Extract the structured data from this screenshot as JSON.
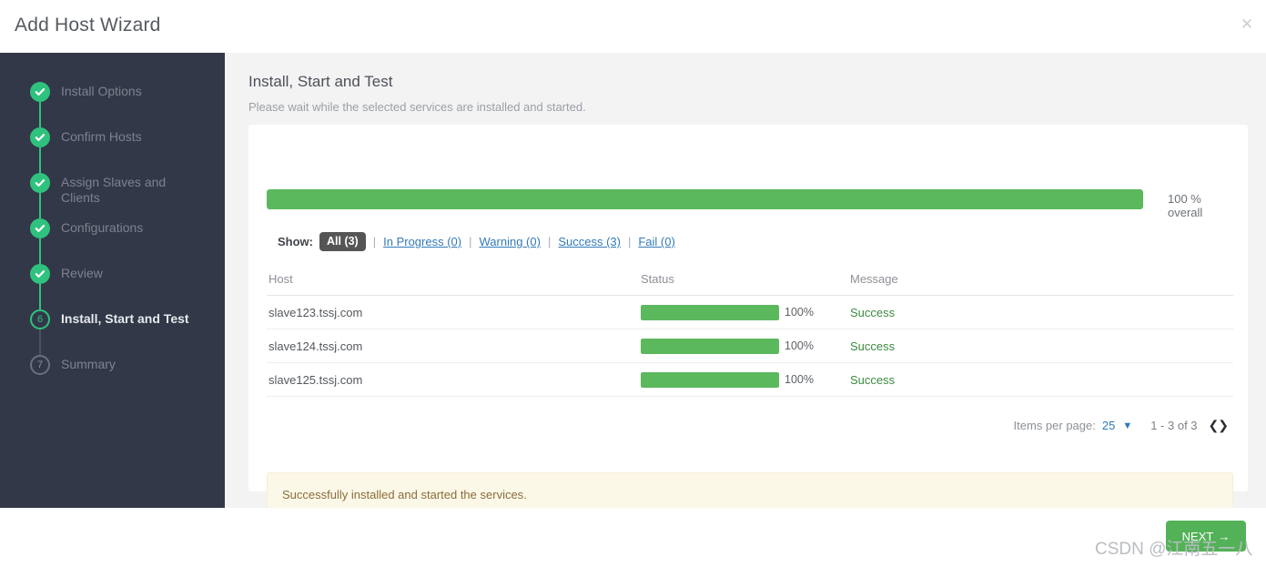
{
  "window": {
    "title": "Add Host Wizard",
    "close_icon": "close-icon"
  },
  "sidebar": {
    "steps": [
      {
        "label": "Install Options",
        "state": "done",
        "marker": "check"
      },
      {
        "label": "Confirm Hosts",
        "state": "done",
        "marker": "check"
      },
      {
        "label": "Assign Slaves and Clients",
        "state": "done",
        "marker": "check"
      },
      {
        "label": "Configurations",
        "state": "done",
        "marker": "check"
      },
      {
        "label": "Review",
        "state": "done",
        "marker": "check"
      },
      {
        "label": "Install, Start and Test",
        "state": "current",
        "marker": "6"
      },
      {
        "label": "Summary",
        "state": "todo",
        "marker": "7"
      }
    ]
  },
  "main": {
    "title": "Install, Start and Test",
    "subtitle": "Please wait while the selected services are installed and started.",
    "overall": {
      "percent": 100,
      "text": "100 % overall"
    },
    "filter": {
      "label": "Show:",
      "separator": "|",
      "options": [
        {
          "label": "All (3)",
          "active": true
        },
        {
          "label": "In Progress (0)",
          "active": false
        },
        {
          "label": "Warning (0)",
          "active": false
        },
        {
          "label": "Success (3)",
          "active": false
        },
        {
          "label": "Fail (0)",
          "active": false
        }
      ]
    },
    "table": {
      "columns": [
        "Host",
        "Status",
        "Message"
      ],
      "rows": [
        {
          "host": "slave123.tssj.com",
          "percent": 100,
          "percent_text": "100%",
          "message": "Success"
        },
        {
          "host": "slave124.tssj.com",
          "percent": 100,
          "percent_text": "100%",
          "message": "Success"
        },
        {
          "host": "slave125.tssj.com",
          "percent": 100,
          "percent_text": "100%",
          "message": "Success"
        }
      ]
    },
    "pagination": {
      "items_per_page_label": "Items per page:",
      "items_per_page_value": "25",
      "range": "1 - 3 of 3",
      "prev_icon": "chevron-left-icon",
      "next_icon": "chevron-right-icon"
    },
    "alert": {
      "message": "Successfully installed and started the services."
    }
  },
  "footer": {
    "next_label": "NEXT",
    "next_arrow": "→"
  },
  "watermark": {
    "text": "CSDN @江南五一八"
  },
  "colors": {
    "sidebar_bg": "#323848",
    "green": "#2fc27e",
    "progress_green": "#5cb85c",
    "link_blue": "#337ab7",
    "alert_bg": "#fcf8e8",
    "alert_text": "#8a6d3b",
    "button_green": "#53b257"
  }
}
